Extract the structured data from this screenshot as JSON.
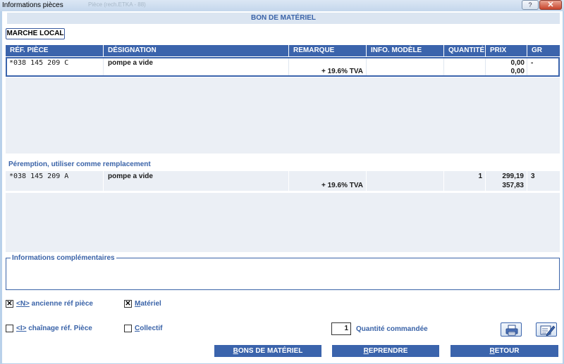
{
  "window": {
    "title": "Informations pièces",
    "faint_title": "Pièce (rech.ETKA - 88)",
    "help_label": "?",
    "close_label": "✕"
  },
  "header": {
    "band_title": "BON DE MATÉRIEL",
    "market_button": "MARCHE LOCAL"
  },
  "table": {
    "columns": [
      "RÉF. PIÈCE",
      "DÉSIGNATION",
      "REMARQUE",
      "INFO. MODÈLE",
      "QUANTITÉ",
      "PRIX",
      "GR"
    ],
    "rows": [
      {
        "ref": "*038 145 209 C",
        "designation": "pompe a vide",
        "remarque": "",
        "tva": "+ 19.6% TVA",
        "info_modele": "",
        "quantite": "",
        "prix": "0,00",
        "prix_ttc": "0,00",
        "gr": "-"
      }
    ]
  },
  "replacement": {
    "section_label": "Péremption, utiliser comme remplacement",
    "rows": [
      {
        "ref": "*038 145 209 A",
        "designation": "pompe a vide",
        "remarque": "",
        "tva": "+ 19.6% TVA",
        "info_modele": "",
        "quantite": "1",
        "prix": "299,19",
        "prix_ttc": "357,83",
        "gr": "3"
      }
    ]
  },
  "info": {
    "label": "Informations complémentaires"
  },
  "options": {
    "ancienne": {
      "key": "<N>",
      "label": " ancienne réf pièce",
      "checked": true,
      "mark": "✕"
    },
    "materiel": {
      "key": "M",
      "label": "atériel",
      "checked": true,
      "mark": "✕"
    },
    "chainage": {
      "key": "<I>",
      "label": " chaînage réf. Pièce",
      "checked": false,
      "mark": ""
    },
    "collectif": {
      "key": "C",
      "label": "ollectif",
      "checked": false,
      "mark": ""
    }
  },
  "order": {
    "quantity": "1",
    "quantity_label": "Quantité commandée"
  },
  "buttons": {
    "bons_key": "B",
    "bons_rest": "ONS DE MATÉRIEL",
    "reprendre_key": "R",
    "reprendre_rest": "EPRENDRE",
    "retour_key": "R",
    "retour_rest": "ETOUR"
  },
  "icons": {
    "print": "printer-icon",
    "edit": "edit-document-icon"
  },
  "colors": {
    "accent": "#3b64ac",
    "band": "#dbe5f1",
    "grey_area": "#ebeff5"
  }
}
